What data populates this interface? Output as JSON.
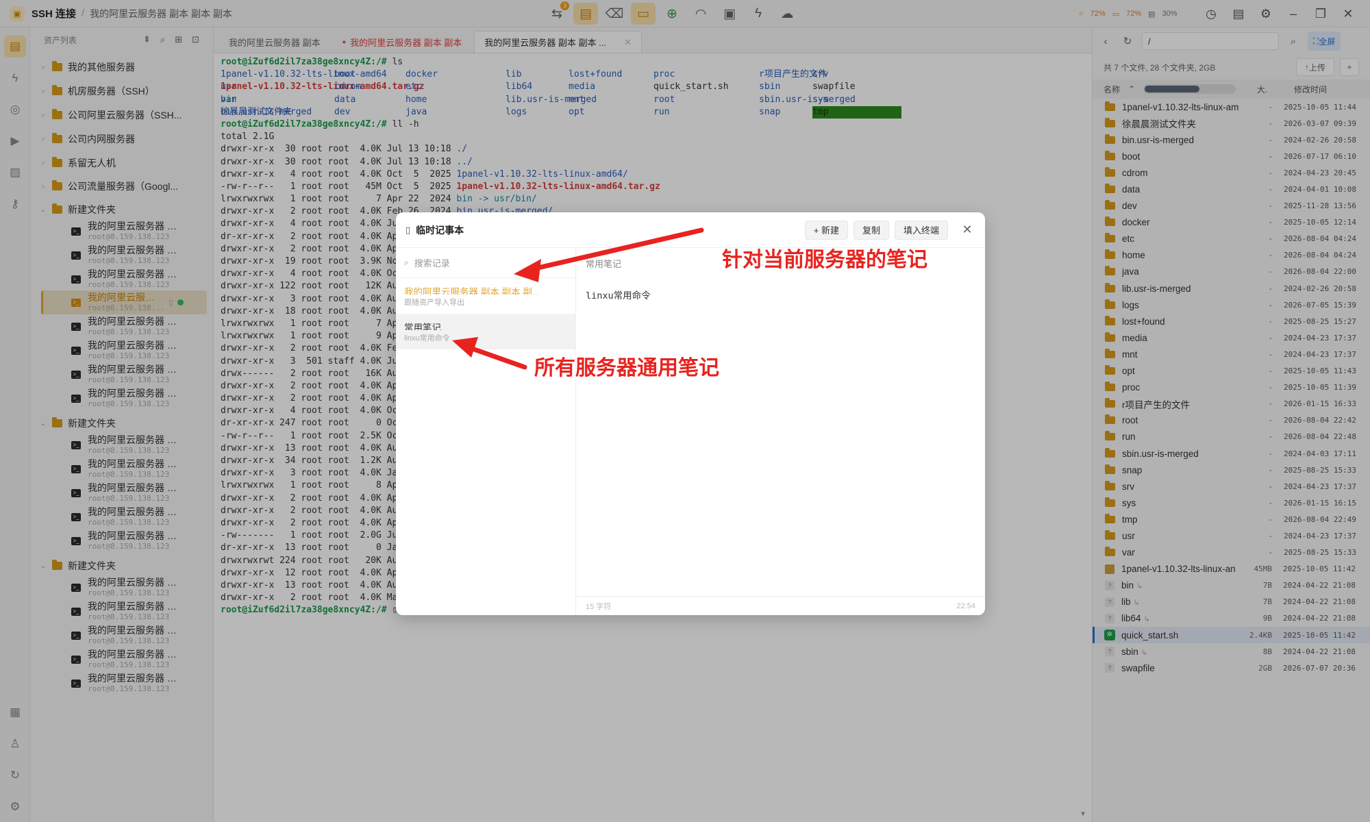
{
  "titlebar": {
    "app_name": "SSH 连接",
    "breadcrumb": "我的阿里云服务器 副本 副本 副本",
    "badge_count": "3",
    "stats": {
      "cpu": "72%",
      "mem": "72%",
      "disk": "30%"
    }
  },
  "sidebar": {
    "title": "资产列表",
    "top_folders": [
      "我的其他服务器",
      "机房服务器（SSH）",
      "公司阿里云服务器（SSH...",
      "公司内网服务器",
      "系留无人机",
      "公司流量服务器（Googl..."
    ],
    "folder1": {
      "name": "新建文件夹",
      "servers": [
        "我的阿里云服务器 副本",
        "我的阿里云服务器 副...",
        "我的阿里云服务器 副...",
        "我的阿里云服务...",
        "我的阿里云服务器 副...",
        "我的阿里云服务器 副...",
        "我的阿里云服务器 副...",
        "我的阿里云服务器 副..."
      ]
    },
    "folder2": {
      "name": "新建文件夹",
      "servers": [
        "我的阿里云服务器 副...",
        "我的阿里云服务器 副...",
        "我的阿里云服务器 副...",
        "我的阿里云服务器 副...",
        "我的阿里云服务器 副..."
      ]
    },
    "folder3": {
      "name": "新建文件夹",
      "servers": [
        "我的阿里云服务器 副...",
        "我的阿里云服务器 副...",
        "我的阿里云服务器 副...",
        "我的阿里云服务器 副...",
        "我的阿里云服务器 副..."
      ]
    },
    "server_ip": "root@8.159.138.123",
    "server_ip_short": "root@8.159.138..."
  },
  "tabs": [
    {
      "label": "我的阿里云服务器 副本",
      "state": "normal"
    },
    {
      "label": "我的阿里云服务器 副本 副本",
      "state": "unsaved"
    },
    {
      "label": "我的阿里云服务器 副本 副本 ...",
      "state": "active"
    }
  ],
  "terminal": {
    "prompt": "root@iZuf6d2il7za38ge8xncy4Z:/#",
    "cmd1": " ls",
    "ls_rows": [
      [
        "1panel-v1.10.32-lts-linux-amd64",
        "boot",
        "docker",
        "lib",
        "lost+found",
        "proc",
        "r项目产生的文件",
        "srv",
        "usr"
      ],
      [
        "1panel-v1.10.32-lts-linux-amd64.tar.gz",
        "cdrom",
        "etc",
        "lib64",
        "media",
        "quick_start.sh",
        "sbin",
        "swapfile",
        "var"
      ],
      [
        "bin",
        "data",
        "home",
        "lib.usr-is-merged",
        "mnt",
        "root",
        "sbin.usr-is-merged",
        "sys",
        "徐晨晨测试文件夹"
      ],
      [
        "bin.usr-is-merged",
        "dev",
        "java",
        "logs",
        "opt",
        "run",
        "snap",
        "tmp",
        ""
      ]
    ],
    "cmd2": " ll -h",
    "total": "total 2.1G",
    "ll_full": [
      {
        "meta": "drwxr-xr-x  30 root root  4.0K Jul 13 10:18 ",
        "name": "./",
        "cls": "c-blue"
      },
      {
        "meta": "drwxr-xr-x  30 root root  4.0K Jul 13 10:18 ",
        "name": "../",
        "cls": "c-blue"
      },
      {
        "meta": "drwxr-xr-x   4 root root  4.0K Oct  5  2025 ",
        "name": "1panel-v1.10.32-lts-linux-amd64/",
        "cls": "c-blue"
      },
      {
        "meta": "-rw-r--r--   1 root root   45M Oct  5  2025 ",
        "name": "1panel-v1.10.32-lts-linux-amd64.tar.gz",
        "cls": "c-red"
      },
      {
        "meta": "lrwxrwxrwx   1 root root     7 Apr 22  2024 ",
        "name": "bin -> usr/bin/",
        "cls": "c-cyan"
      },
      {
        "meta": "drwxr-xr-x   2 root root  4.0K Feb 26  2024 ",
        "name": "bin.usr-is-merged/",
        "cls": "c-blue"
      }
    ],
    "ll_partial": [
      "drwxr-xr-x   4 root root  4.0K Ju",
      "dr-xr-xr-x   2 root root  4.0K Ap",
      "drwxr-xr-x   2 root root  4.0K Ap",
      "drwxr-xr-x  19 root root  3.9K No",
      "drwxr-xr-x   4 root root  4.0K Oc",
      "drwxr-xr-x 122 root root   12K Au",
      "drwxr-xr-x   3 root root  4.0K Au",
      "drwxr-xr-x  18 root root  4.0K Au",
      "lrwxrwxrwx   1 root root     7 Ap",
      "lrwxrwxrwx   1 root root     9 Ap",
      "drwxr-xr-x   2 root root  4.0K Fe",
      "drwxr-xr-x   3  501 staff 4.0K Ju",
      "drwx------   2 root root   16K Au",
      "drwxr-xr-x   2 root root  4.0K Ap",
      "drwxr-xr-x   2 root root  4.0K Ap",
      "drwxr-xr-x   4 root root  4.0K Oc",
      "dr-xr-xr-x 247 root root     0 Oc",
      "-rw-r--r--   1 root root  2.5K Oc",
      "drwxr-xr-x  13 root root  4.0K Au",
      "drwxr-xr-x  34 root root  1.2K Au",
      "drwxr-xr-x   3 root root  4.0K Ja",
      "lrwxrwxrwx   1 root root     8 Ap",
      "drwxr-xr-x   2 root root  4.0K Ap",
      "drwxr-xr-x   2 root root  4.0K Au",
      "drwxr-xr-x   2 root root  4.0K Ap",
      "-rw-------   1 root root  2.0G Ju",
      "dr-xr-xr-x  13 root root     0 Ja",
      "drwxrwxrwt 224 root root   20K Au",
      "drwxr-xr-x  12 root root  4.0K Ap",
      "drwxr-xr-x  13 root root  4.0K Au",
      "drwxr-xr-x   2 root root  4.0K Ma"
    ]
  },
  "files": {
    "path": "/",
    "full_label": "全屏",
    "summary": "共 7 个文件, 28 个文件夹, 2GB",
    "upload_label": "上传",
    "add_label": "+",
    "col_name": "名称",
    "col_size": "大.",
    "col_date": "修改时间",
    "rows": [
      {
        "name": "1panel-v1.10.32-lts-linux-am",
        "size": "-",
        "date": "2025-10-05 11:44",
        "type": "folder"
      },
      {
        "name": "徐晨晨测试文件夹",
        "size": "-",
        "date": "2026-03-07 09:39",
        "type": "folder"
      },
      {
        "name": "bin.usr-is-merged",
        "size": "-",
        "date": "2024-02-26 20:58",
        "type": "folder"
      },
      {
        "name": "boot",
        "size": "-",
        "date": "2026-07-17 06:10",
        "type": "folder"
      },
      {
        "name": "cdrom",
        "size": "-",
        "date": "2024-04-23 20:45",
        "type": "folder"
      },
      {
        "name": "data",
        "size": "-",
        "date": "2024-04-01 10:08",
        "type": "folder"
      },
      {
        "name": "dev",
        "size": "-",
        "date": "2025-11-28 13:56",
        "type": "folder"
      },
      {
        "name": "docker",
        "size": "-",
        "date": "2025-10-05 12:14",
        "type": "folder"
      },
      {
        "name": "etc",
        "size": "-",
        "date": "2026-08-04 04:24",
        "type": "folder"
      },
      {
        "name": "home",
        "size": "-",
        "date": "2026-08-04 04:24",
        "type": "folder"
      },
      {
        "name": "java",
        "size": "-",
        "date": "2026-08-04 22:00",
        "type": "folder"
      },
      {
        "name": "lib.usr-is-merged",
        "size": "-",
        "date": "2024-02-26 20:58",
        "type": "folder"
      },
      {
        "name": "logs",
        "size": "-",
        "date": "2026-07-05 15:39",
        "type": "folder"
      },
      {
        "name": "lost+found",
        "size": "-",
        "date": "2025-08-25 15:27",
        "type": "folder"
      },
      {
        "name": "media",
        "size": "-",
        "date": "2024-04-23 17:37",
        "type": "folder"
      },
      {
        "name": "mnt",
        "size": "-",
        "date": "2024-04-23 17:37",
        "type": "folder"
      },
      {
        "name": "opt",
        "size": "-",
        "date": "2025-10-05 11:43",
        "type": "folder"
      },
      {
        "name": "proc",
        "size": "-",
        "date": "2025-10-05 11:39",
        "type": "folder"
      },
      {
        "name": "r项目产生的文件",
        "size": "-",
        "date": "2026-01-15 16:33",
        "type": "folder"
      },
      {
        "name": "root",
        "size": "-",
        "date": "2026-08-04 22:42",
        "type": "folder"
      },
      {
        "name": "run",
        "size": "-",
        "date": "2026-08-04 22:48",
        "type": "folder"
      },
      {
        "name": "sbin.usr-is-merged",
        "size": "-",
        "date": "2024-04-03 17:11",
        "type": "folder"
      },
      {
        "name": "snap",
        "size": "-",
        "date": "2025-08-25 15:33",
        "type": "folder"
      },
      {
        "name": "srv",
        "size": "-",
        "date": "2024-04-23 17:37",
        "type": "folder"
      },
      {
        "name": "sys",
        "size": "-",
        "date": "2026-01-15 16:15",
        "type": "folder"
      },
      {
        "name": "tmp",
        "size": "-",
        "date": "2026-08-04 22:49",
        "type": "folder"
      },
      {
        "name": "usr",
        "size": "-",
        "date": "2024-04-23 17:37",
        "type": "folder"
      },
      {
        "name": "var",
        "size": "-",
        "date": "2025-08-25 15:33",
        "type": "folder"
      },
      {
        "name": "1panel-v1.10.32-lts-linux-an",
        "size": "45MB",
        "date": "2025-10-05 11:42",
        "type": "archive"
      },
      {
        "name": "bin",
        "size": "7B",
        "date": "2024-04-22 21:08",
        "type": "link"
      },
      {
        "name": "lib",
        "size": "7B",
        "date": "2024-04-22 21:08",
        "type": "link"
      },
      {
        "name": "lib64",
        "size": "9B",
        "date": "2024-04-22 21:08",
        "type": "link"
      },
      {
        "name": "quick_start.sh",
        "size": "2.4KB",
        "date": "2025-10-05 11:42",
        "type": "exec",
        "selected": true
      },
      {
        "name": "sbin",
        "size": "8B",
        "date": "2024-04-22 21:08",
        "type": "link"
      },
      {
        "name": "swapfile",
        "size": "2GB",
        "date": "2026-07-07 20:36",
        "type": "file"
      }
    ]
  },
  "modal": {
    "title": "临时记事本",
    "new_label": "+ 新建",
    "copy_label": "复制",
    "fill_label": "填入终端",
    "search_placeholder": "搜索记录",
    "notes": [
      {
        "title": "我的阿里云服务器 副本 副本 副...",
        "subtitle": "跟随资产导入导出",
        "kind": "server"
      },
      {
        "title": "常用笔记",
        "subtitle": "linxu常用命令",
        "kind": "general"
      }
    ],
    "current_title": "常用笔记",
    "current_body": "linxu常用命令",
    "char_count": "15 字符",
    "time": "22:54"
  },
  "annotations": {
    "server_note": "针对当前服务器的笔记",
    "general_note": "所有服务器通用笔记",
    "color": "#e8231f"
  },
  "colors": {
    "accent": "#e0a533",
    "prompt": "#1a9a4a",
    "link": "#2a6ed6"
  }
}
